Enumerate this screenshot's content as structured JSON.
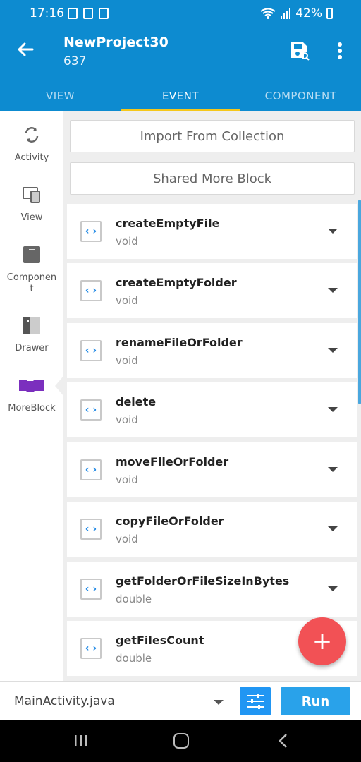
{
  "status_bar": {
    "time": "17:16",
    "battery": "42%"
  },
  "app_bar": {
    "title": "NewProject30",
    "subtitle": "637"
  },
  "tabs": [
    {
      "label": "VIEW",
      "selected": false
    },
    {
      "label": "EVENT",
      "selected": true
    },
    {
      "label": "COMPONENT",
      "selected": false
    }
  ],
  "sidebar": {
    "items": [
      {
        "label": "Activity",
        "icon": "activity-icon"
      },
      {
        "label": "View",
        "icon": "view-icon"
      },
      {
        "label": "Componen\nt",
        "icon": "component-icon"
      },
      {
        "label": "Drawer",
        "icon": "drawer-icon"
      },
      {
        "label": "MoreBlock",
        "icon": "moreblock-icon",
        "selected": true
      }
    ]
  },
  "actions": {
    "import_label": "Import From Collection",
    "shared_label": "Shared More Block"
  },
  "moreblocks": [
    {
      "name": "createEmptyFile",
      "type": "void"
    },
    {
      "name": "createEmptyFolder",
      "type": "void"
    },
    {
      "name": "renameFileOrFolder",
      "type": "void"
    },
    {
      "name": "delete",
      "type": "void"
    },
    {
      "name": "moveFileOrFolder",
      "type": "void"
    },
    {
      "name": "copyFileOrFolder",
      "type": "void"
    },
    {
      "name": "getFolderOrFileSizeInBytes",
      "type": "double"
    },
    {
      "name": "getFilesCount",
      "type": "double"
    }
  ],
  "fab": {
    "symbol": "+"
  },
  "bottom_bar": {
    "file": "MainActivity.java",
    "run_label": "Run"
  },
  "colors": {
    "primary": "#0d8bd0",
    "accent": "#f5c71a",
    "fab": "#f25155",
    "run": "#29a2ea"
  }
}
